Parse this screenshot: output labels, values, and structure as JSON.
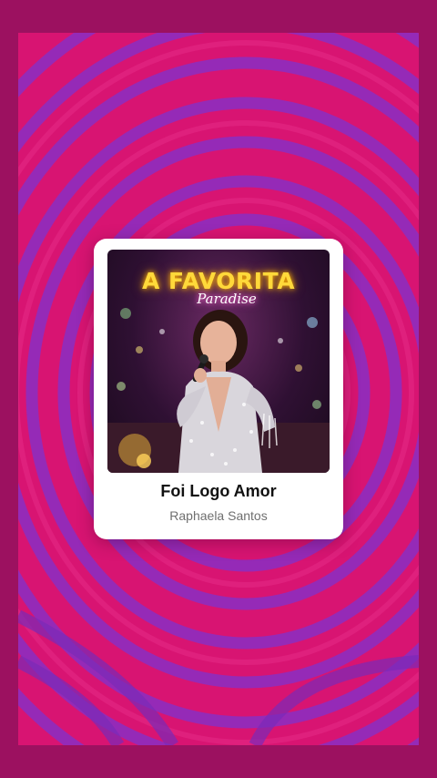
{
  "card": {
    "title": "Foi Logo Amor",
    "artist": "Raphaela Santos"
  },
  "artwork": {
    "title_text": "A FAVORITA",
    "subtitle_text": "Paradise"
  },
  "colors": {
    "page_background": "#9c1160",
    "frame_background": "#d81472",
    "swirl_stripe": "#8a2fc4",
    "card_background": "#ffffff",
    "title_color": "#111111",
    "artist_color": "#6f6f6f",
    "artwork_title_color": "#ffd93a"
  }
}
